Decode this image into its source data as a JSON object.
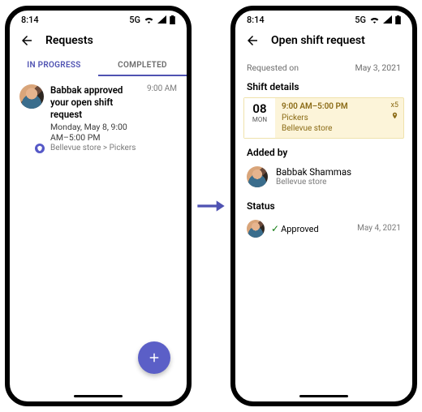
{
  "status": {
    "time": "8:14",
    "network": "5G"
  },
  "left": {
    "title": "Requests",
    "tabs": {
      "in_progress": "IN PROGRESS",
      "completed": "COMPLETED"
    },
    "item": {
      "title": "Babbak approved your open shift request",
      "sub": "Monday, May 8, 9:00 AM–5:00 PM",
      "meta": "Bellevue store > Pickers",
      "time": "9:00 AM"
    }
  },
  "right": {
    "title": "Open shift request",
    "requested_label": "Requested on",
    "requested_date": "May 3, 2021",
    "shift_details_label": "Shift details",
    "shift": {
      "day": "08",
      "dow": "MON",
      "time": "9:00 AM–5:00 PM",
      "group": "Pickers",
      "store": "Bellevue store",
      "count": "x5"
    },
    "added_by_label": "Added by",
    "added_by": {
      "name": "Babbak Shammas",
      "store": "Bellevue store"
    },
    "status_label": "Status",
    "status": {
      "text": "Approved",
      "date": "May 4, 2021"
    }
  }
}
